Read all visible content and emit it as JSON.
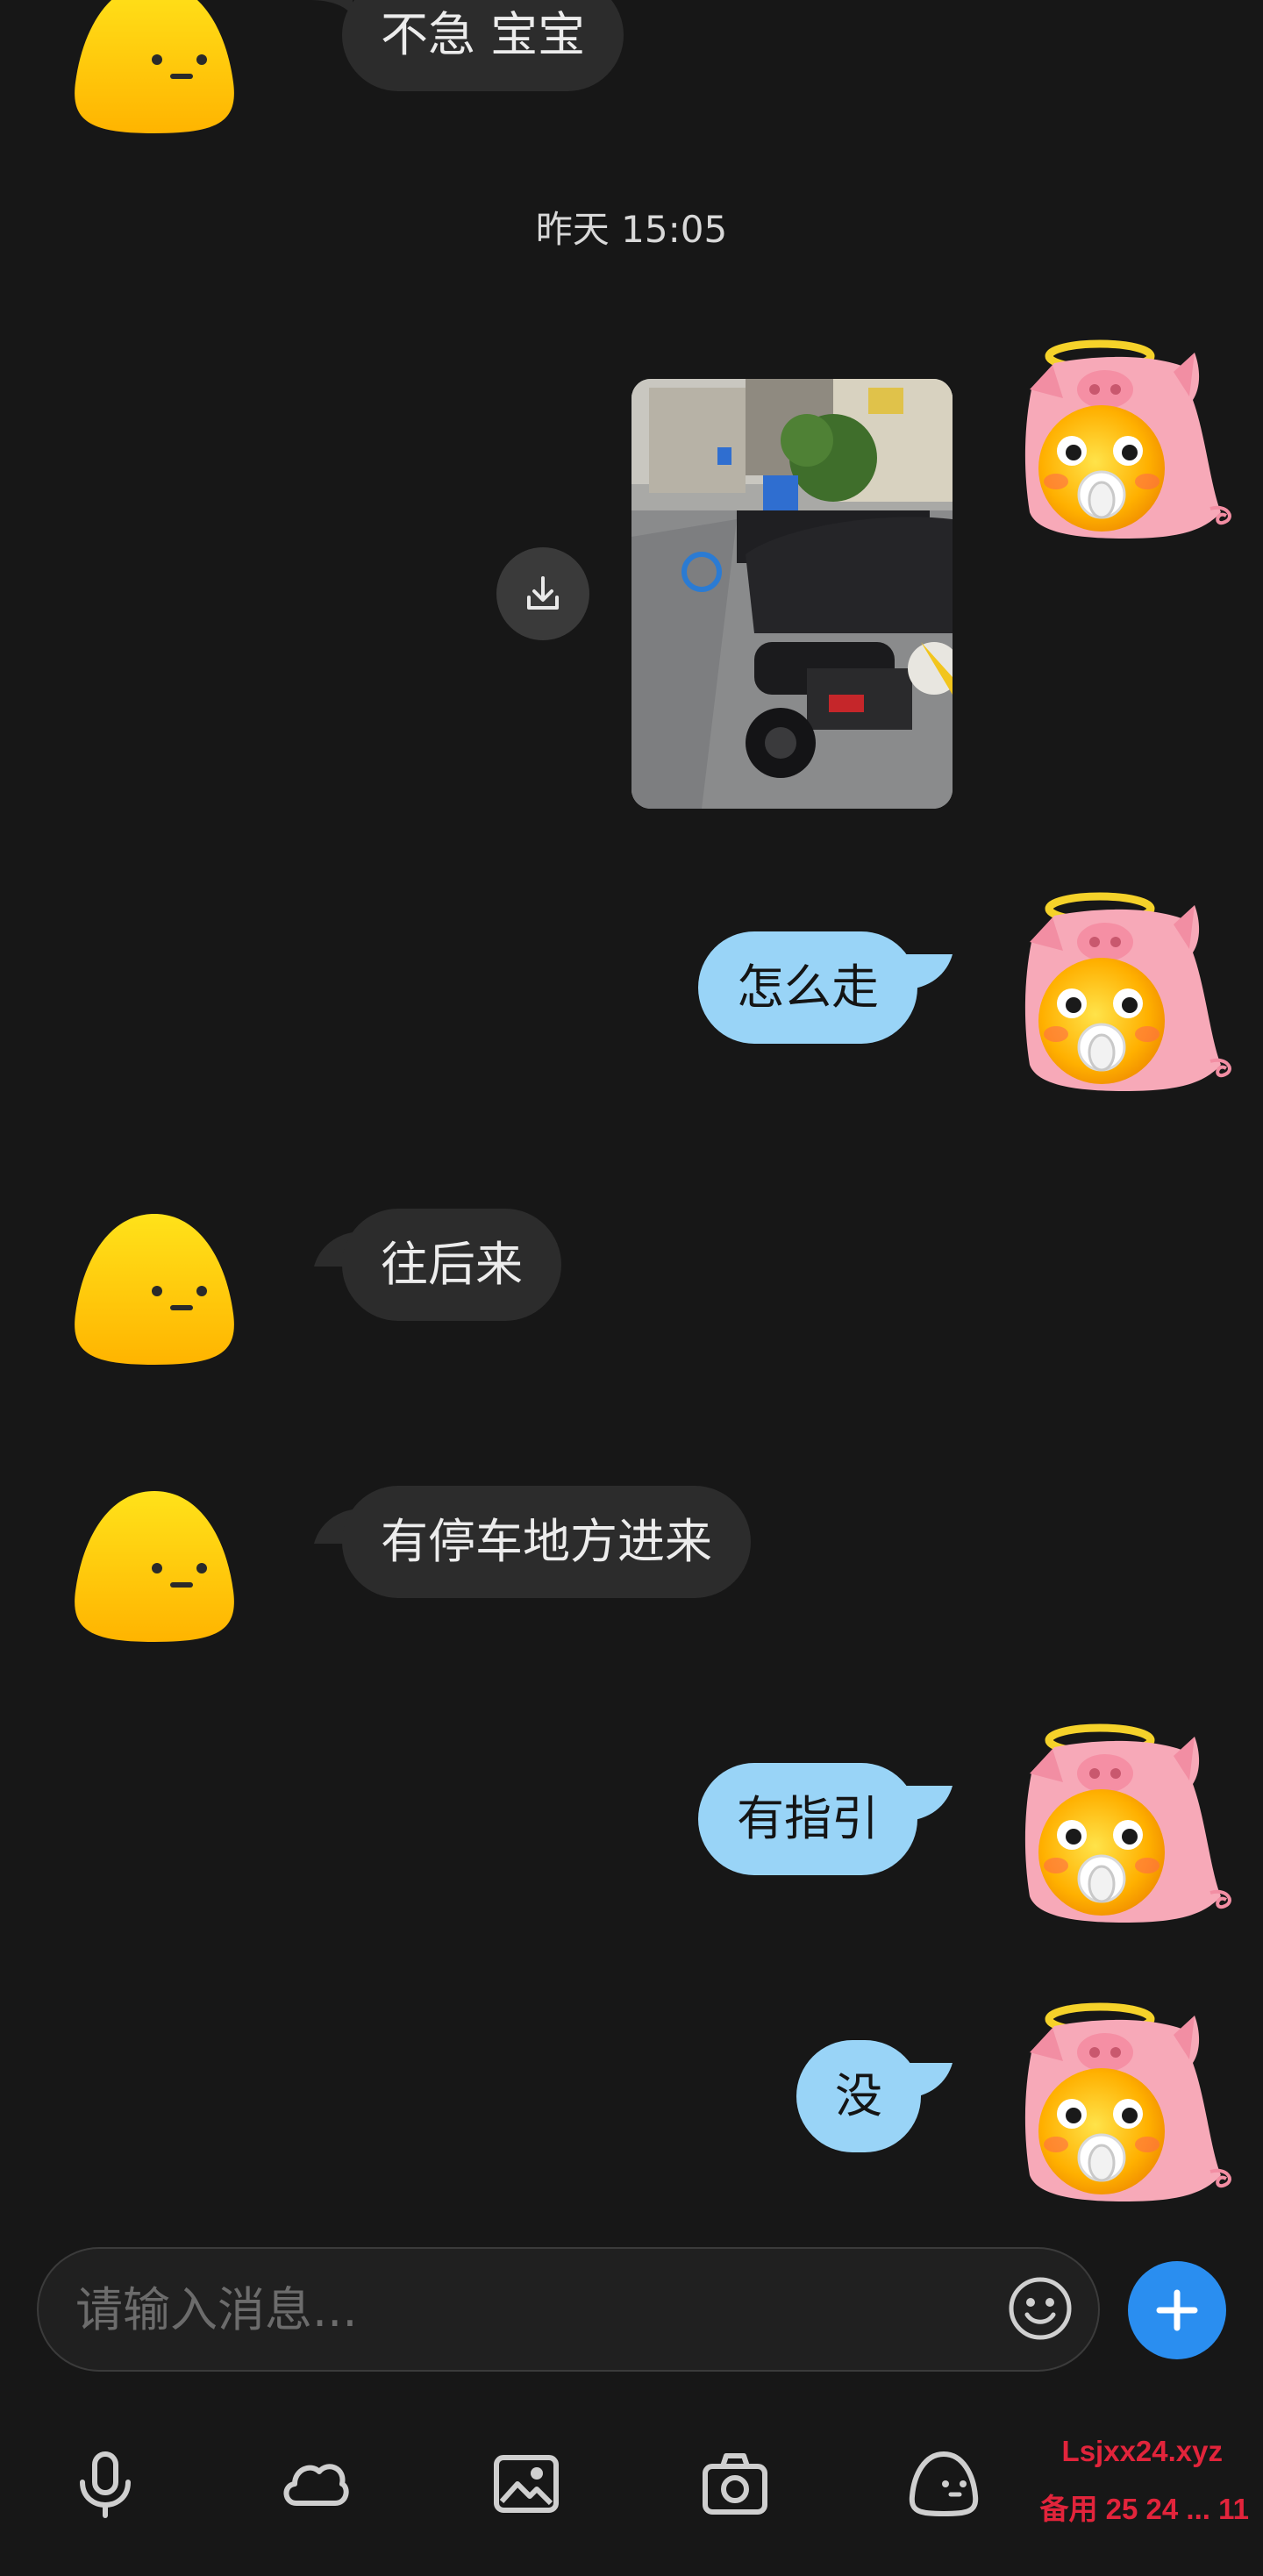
{
  "messages": [
    {
      "id": "m1",
      "side": "in",
      "text": "不急 宝宝"
    },
    {
      "id": "ts",
      "type": "timestamp",
      "text": "昨天 15:05"
    },
    {
      "id": "m2",
      "side": "out",
      "type": "image",
      "alt": ""
    },
    {
      "id": "m3",
      "side": "out",
      "text": "怎么走"
    },
    {
      "id": "m4",
      "side": "in",
      "text": "往后来"
    },
    {
      "id": "m5",
      "side": "in",
      "text": "有停车地方进来"
    },
    {
      "id": "m6",
      "side": "out",
      "text": "有指引"
    },
    {
      "id": "m7",
      "side": "out",
      "text": "没"
    }
  ],
  "composer": {
    "placeholder": "请输入消息..."
  },
  "toolbar": {
    "items": [
      "microphone-icon",
      "cloud-icon",
      "image-icon",
      "camera-icon",
      "sticker-icon"
    ]
  },
  "watermark": {
    "line1": "Lsjxx24.xyz",
    "line2": "备用 25 24 ... 11"
  },
  "colors": {
    "background": "#171717",
    "incoming_bubble": "#2c2c2c",
    "outgoing_bubble": "#99d4f7",
    "accent": "#2a8ef0",
    "watermark": "#e2243b"
  }
}
